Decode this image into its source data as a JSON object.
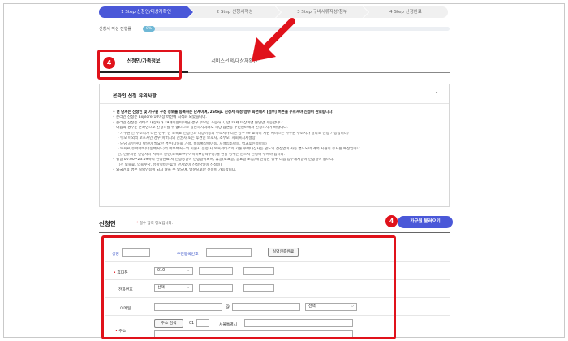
{
  "steps": [
    {
      "label": "1 Step 신청인/대상자확인"
    },
    {
      "label": "2 Step 신청서작성"
    },
    {
      "label": "3 Step 구비서류작성/첨부"
    },
    {
      "label": "4 Step 신청완료"
    }
  ],
  "progress": {
    "label": "신청서 작성 진행률",
    "value_text": "0%",
    "value": 0
  },
  "tabs": [
    {
      "label": "신청인/가족정보",
      "active": true
    },
    {
      "label": "서비스선택/대상자확인",
      "active": false
    }
  ],
  "badges": {
    "tab": "4",
    "load_button": "4"
  },
  "notice": {
    "title": "온라인 신청 유의사항",
    "lines": [
      "현 단계는 신청인 및 가구원 구성 정보를 등록하는 단계이며, 2Step. 신청서 작성/첨부 화면에서 [첨부] 버튼을 누르셔야 신청이 완료됩니다.",
      "온라인 신청은 Explorer10이상 버전에 최적화 되었습니다.",
      "온라인 신청은 서비스 대상자가 19세이만이 아닌 경우 부모만 가능하고, 만 19세 이상이면 본인만 가능합니다.",
      "다음의 경우는 온라인으로 신청하실 수 없으므로 불편하시더라도 해당 읍면동 주민센터에서 신청하시기 바랍니다.",
      "- 가구원 간 주소지가 다른 경우, 단 보육료 신청인과 대상아동의 주소지가 다른 경우 (※ 교육비 지원 서비스는 가구원 주소지가 달라도 신청 가능합니다)",
      "- 부모 미외의 보호자인 경우(아버지의 친권자 또는 후견인 보호자, 조부모, 사회복지시설장)",
      "- 당당 공무원이 확인이 필요한 경우(다문화 가정, 비동록장애아동, 시설입소아동, 법과후신청아동)",
      "- 보육료/유아학비(아동배커드)의 바우배커드의 지원지 신청 시 보육서비스의 기존 수배대상자는 별도의 신청없이 자동 변도되어 계속 지원이 유지될 예정입니다.",
      "단, 신규지원 신청자나 서비스 변경(보육료↔유아학비↔양육수당)을 원할 경우는 반드시 신청해 주셔야 합니다.",
      "평일 00:00~23:59까지 신청완료 시 신청당일이 신청일이되며, 휴일(토요일, 일요일 포함)에 신청한 경우 다음 업무게시일이 신청일이 됩니다.",
      "(단, 보육료, 양육수당, 유아학비는휴일 관계없이 신청당일이 신청일)",
      "외국인의 경우 실명인증이 되지 않을 수 있으며, 방문으로만 신청이 가능합니다."
    ]
  },
  "applicant": {
    "title": "신청인",
    "note_star": "*",
    "note": "필수 입력 정보입니다.",
    "load_button": "가구원 불러오기",
    "name_label": "성명",
    "rrn_label": "주민등록번호",
    "verify_button": "실명인증완료",
    "mobile_label": "휴대폰",
    "mobile_prefix": "010",
    "phone_label": "전화번호",
    "phone_select": "선택",
    "email_label": "이메일",
    "email_at": "@",
    "email_select": "선택",
    "address_label": "주소",
    "address_search": "주소 검색",
    "zip_value": "01",
    "address_value": "서울특별시"
  },
  "colors": {
    "accent": "#4a58d8",
    "highlight": "#e0121b",
    "progress": "#6fb8d6"
  }
}
